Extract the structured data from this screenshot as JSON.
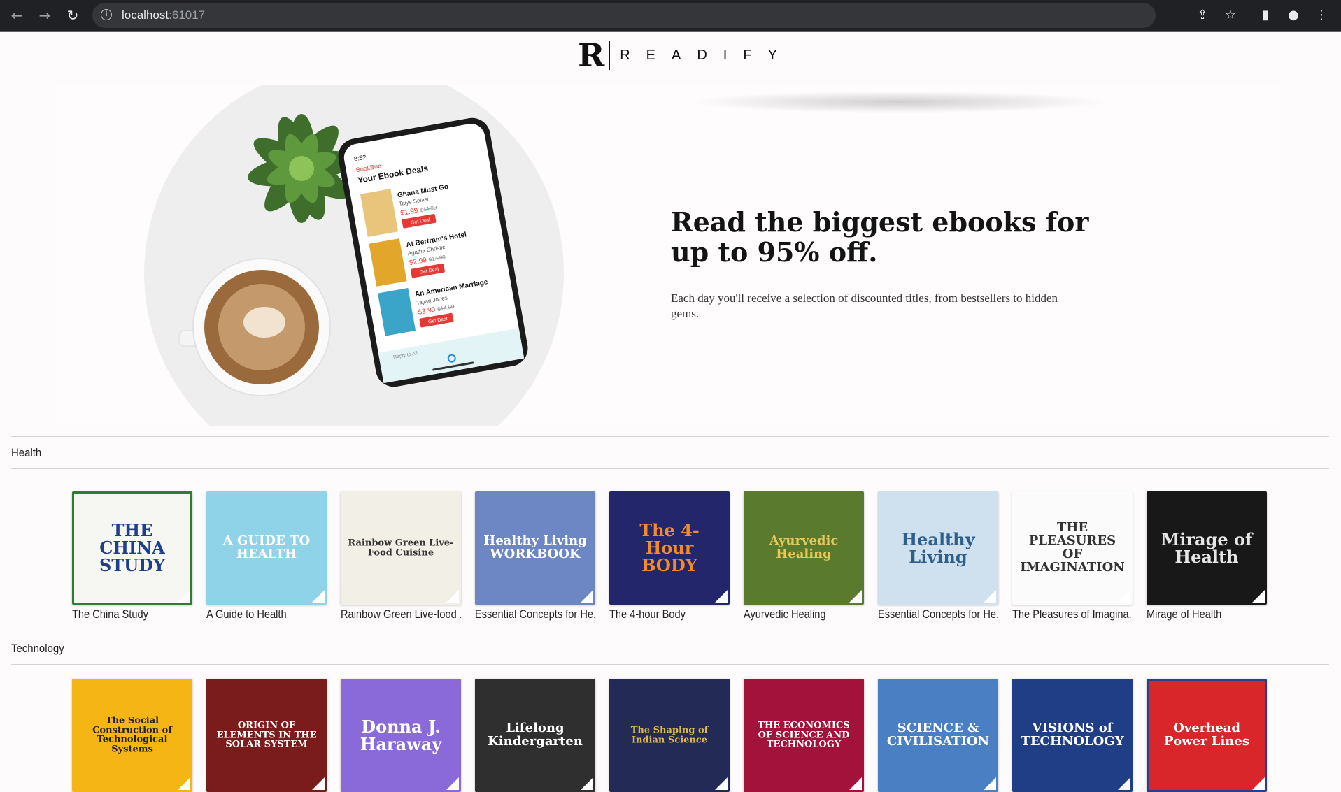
{
  "browser": {
    "url_host": "localhost",
    "url_port": ":61017"
  },
  "brand": {
    "logo_letter": "R",
    "logo_word": "READIFY"
  },
  "hero": {
    "title": "Read the biggest ebooks for up to 95% off.",
    "subtitle": "Each day you'll receive a selection of discounted titles, from bestsellers to hidden gems.",
    "phone": {
      "time": "8:52",
      "app": "BookBub",
      "header": "Your Ebook Deals",
      "deals": [
        {
          "title": "Ghana Must Go",
          "author": "Taiye Selasi",
          "price": "$1.99",
          "old": "$14.99",
          "button": "Get Deal"
        },
        {
          "title": "At Bertram's Hotel",
          "author": "Agatha Christie",
          "price": "$2.99",
          "old": "$14.99",
          "button": "Get Deal"
        },
        {
          "title": "An American Marriage",
          "author": "Tayari Jones",
          "price": "$3.99",
          "old": "$14.99",
          "button": "Get Deal"
        }
      ],
      "reply": "Reply to All"
    }
  },
  "sections": [
    {
      "label": "Health",
      "books": [
        {
          "title": "The China Study",
          "cover_text": "THE CHINA STUDY",
          "bg": "#f6f6f2",
          "fg": "#1f3f8a",
          "border": "#2e7d32"
        },
        {
          "title": "A Guide to Health",
          "cover_text": "A GUIDE TO HEALTH",
          "bg": "#8fd3e8",
          "fg": "#ffffff",
          "border": "#8fd3e8"
        },
        {
          "title": "Rainbow Green Live-food ...",
          "cover_text": "Rainbow Green Live-Food Cuisine",
          "bg": "#f2efe6",
          "fg": "#333333",
          "border": "#f2efe6"
        },
        {
          "title": "Essential Concepts for He...",
          "cover_text": "Healthy Living WORKBOOK",
          "bg": "#6d86c4",
          "fg": "#ffffff",
          "border": "#6d86c4"
        },
        {
          "title": "The 4-hour Body",
          "cover_text": "The 4-Hour BODY",
          "bg": "#23266b",
          "fg": "#f28c28",
          "border": "#23266b"
        },
        {
          "title": "Ayurvedic Healing",
          "cover_text": "Ayurvedic Healing",
          "bg": "#5a7a2e",
          "fg": "#e8c75a",
          "border": "#5a7a2e"
        },
        {
          "title": "Essential Concepts for He...",
          "cover_text": "Healthy Living",
          "bg": "#cfe0ee",
          "fg": "#2e5f8a",
          "border": "#cfe0ee"
        },
        {
          "title": "The Pleasures of Imagina...",
          "cover_text": "THE PLEASURES OF IMAGINATION",
          "bg": "#fbfbfb",
          "fg": "#333333",
          "border": "#fbfbfb"
        },
        {
          "title": "Mirage of Health",
          "cover_text": "Mirage of Health",
          "bg": "#181818",
          "fg": "#e6e6e6",
          "border": "#181818"
        }
      ]
    },
    {
      "label": "Technology",
      "books": [
        {
          "cover_text": "The Social Construction of Technological Systems",
          "bg": "#f5b515",
          "fg": "#222222",
          "border": "#f5b515"
        },
        {
          "cover_text": "ORIGIN OF ELEMENTS IN THE SOLAR SYSTEM",
          "bg": "#7a1c1c",
          "fg": "#ffffff",
          "border": "#7a1c1c"
        },
        {
          "cover_text": "Donna J. Haraway",
          "bg": "#8a6ad8",
          "fg": "#ffffff",
          "border": "#8a6ad8"
        },
        {
          "cover_text": "Lifelong Kindergarten",
          "bg": "#2f2f2f",
          "fg": "#ffffff",
          "border": "#2f2f2f"
        },
        {
          "cover_text": "The Shaping of Indian Science",
          "bg": "#232a55",
          "fg": "#e0b84a",
          "border": "#232a55"
        },
        {
          "cover_text": "THE ECONOMICS OF SCIENCE AND TECHNOLOGY",
          "bg": "#a3123a",
          "fg": "#ffffff",
          "border": "#a3123a"
        },
        {
          "cover_text": "SCIENCE & CIVILISATION",
          "bg": "#4a7fc4",
          "fg": "#ffffff",
          "border": "#4a7fc4"
        },
        {
          "cover_text": "VISIONS of TECHNOLOGY",
          "bg": "#1f3e86",
          "fg": "#ffffff",
          "border": "#1f3e86"
        },
        {
          "cover_text": "Overhead Power Lines",
          "bg": "#d8262a",
          "fg": "#ffffff",
          "border": "#2a3f8a"
        }
      ]
    }
  ]
}
